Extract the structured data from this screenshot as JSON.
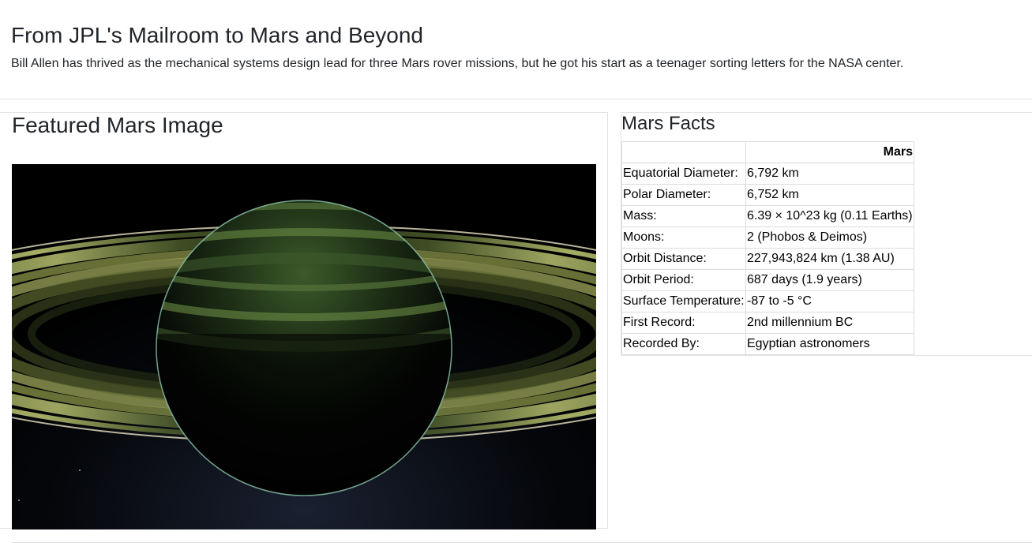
{
  "news": {
    "title": "From JPL's Mailroom to Mars and Beyond",
    "teaser": "Bill Allen has thrived as the mechanical systems design lead for three Mars rover missions, but he got his start as a teenager sorting letters for the NASA center."
  },
  "featured": {
    "title": "Featured Mars Image"
  },
  "facts": {
    "title": "Mars Facts",
    "header": [
      "",
      "Mars"
    ],
    "rows": [
      {
        "label": "Equatorial Diameter:",
        "value": "6,792 km"
      },
      {
        "label": "Polar Diameter:",
        "value": "6,752 km"
      },
      {
        "label": "Mass:",
        "value": "6.39 × 10^23 kg (0.11 Earths)"
      },
      {
        "label": "Moons:",
        "value": "2 (Phobos & Deimos)"
      },
      {
        "label": "Orbit Distance:",
        "value": "227,943,824 km (1.38 AU)"
      },
      {
        "label": "Orbit Period:",
        "value": "687 days (1.9 years)"
      },
      {
        "label": "Surface Temperature:",
        "value": "-87 to -5 °C"
      },
      {
        "label": "First Record:",
        "value": "2nd millennium BC"
      },
      {
        "label": "Recorded By:",
        "value": "Egyptian astronomers"
      }
    ]
  }
}
